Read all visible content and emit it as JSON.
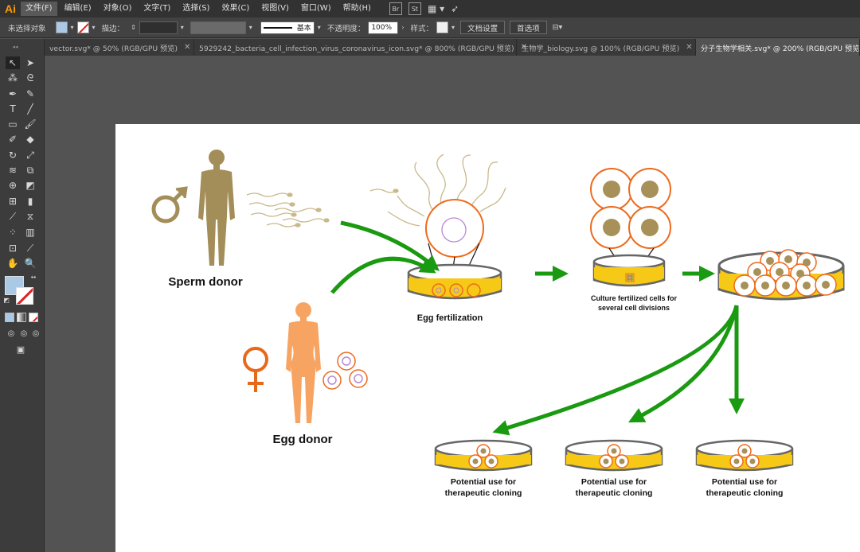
{
  "app": {
    "logo": "Ai"
  },
  "menu": [
    "文件(F)",
    "编辑(E)",
    "对象(O)",
    "文字(T)",
    "选择(S)",
    "效果(C)",
    "视图(V)",
    "窗口(W)",
    "帮助(H)"
  ],
  "control_bar": {
    "selection_label": "未选择对象",
    "stroke_label": "描边：",
    "stroke_profile": "基本",
    "opacity_label": "不透明度：",
    "opacity_value": "100%",
    "style_label": "样式：",
    "doc_setup_button": "文档设置",
    "preferences_button": "首选项"
  },
  "tabs": [
    {
      "label": "vector.svg* @ 50% (RGB/GPU 预览)",
      "active": false
    },
    {
      "label": "5929242_bacteria_cell_infection_virus_coronavirus_icon.svg* @ 800% (RGB/GPU 预览)",
      "active": false
    },
    {
      "label": "生物学_biology.svg @ 100% (RGB/GPU 预览)",
      "active": false
    },
    {
      "label": "分子生物学相关.svg* @ 200% (RGB/GPU 预览)",
      "active": true
    }
  ],
  "artwork": {
    "sperm_donor": "Sperm donor",
    "egg_donor": "Egg donor",
    "egg_fertilization": "Egg fertilization",
    "culture_line1": "Culture fertilized cells  for",
    "culture_line2": "several cell divisions",
    "clone_line1": "Potential use for",
    "clone_line2": "therapeutic cloning"
  },
  "colors": {
    "male": "#a38d58",
    "female": "#f7a463",
    "female_symbol": "#e8681a",
    "cell_outline": "#ed6a1c",
    "nucleus": "#a79159",
    "medium": "#f6c917",
    "arrow": "#1a9a10",
    "fill_swatch": "#a9c9e4"
  }
}
